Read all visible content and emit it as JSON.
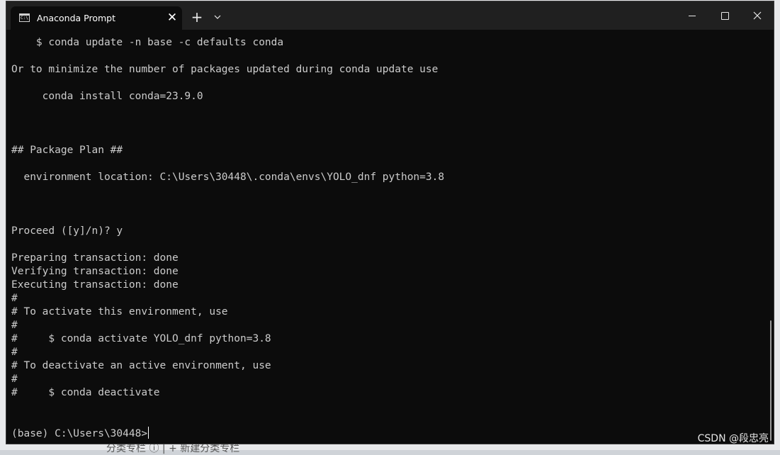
{
  "window": {
    "tab_title": "Anaconda Prompt",
    "tab_icon": "command-prompt-icon",
    "tab_icon_text": "C:\\",
    "new_tab_symbol": "+",
    "close_symbol": "✕"
  },
  "terminal": {
    "lines": [
      "    $ conda update -n base -c defaults conda",
      "",
      "Or to minimize the number of packages updated during conda update use",
      "",
      "     conda install conda=23.9.0",
      "",
      "",
      "",
      "## Package Plan ##",
      "",
      "  environment location: C:\\Users\\30448\\.conda\\envs\\YOLO_dnf python=3.8",
      "",
      "",
      "",
      "Proceed ([y]/n)? y",
      "",
      "Preparing transaction: done",
      "Verifying transaction: done",
      "Executing transaction: done",
      "#",
      "# To activate this environment, use",
      "#",
      "#     $ conda activate YOLO_dnf python=3.8",
      "#",
      "# To deactivate an active environment, use",
      "#",
      "#     $ conda deactivate"
    ],
    "prompt": "(base) C:\\Users\\30448>"
  },
  "watermark": "CSDN @段忠亮",
  "behind_text": "分类专栏 ⓘ  | + 新建分类专栏"
}
